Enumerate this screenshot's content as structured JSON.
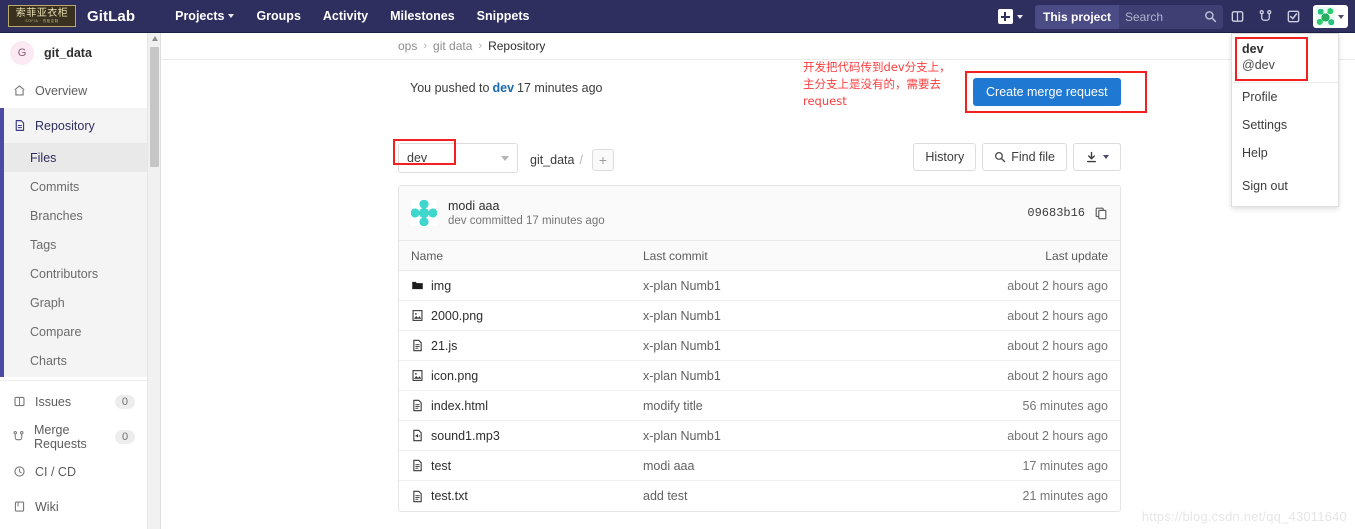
{
  "navbar": {
    "logo_cn": "索菲亚衣柜",
    "logo_sub": "SOFIA · 衣柜定制",
    "brand": "GitLab",
    "links": [
      {
        "label": "Projects",
        "has_caret": true
      },
      {
        "label": "Groups",
        "has_caret": false
      },
      {
        "label": "Activity",
        "has_caret": false
      },
      {
        "label": "Milestones",
        "has_caret": false
      },
      {
        "label": "Snippets",
        "has_caret": false
      }
    ],
    "plus_icon": "plus-icon",
    "scope_label": "This project",
    "search_placeholder": "Search",
    "search_icon": "search-icon",
    "icons": [
      {
        "name": "issues-icon"
      },
      {
        "name": "merge-requests-icon"
      },
      {
        "name": "todos-icon"
      }
    ],
    "avatar_icon": "user-avatar"
  },
  "sidebar": {
    "project_initial": "G",
    "project_name": "git_data",
    "overview": {
      "label": "Overview",
      "icon": "home-icon"
    },
    "repository": {
      "label": "Repository",
      "icon": "file-icon"
    },
    "repo_children": [
      {
        "label": "Files",
        "selected": true
      },
      {
        "label": "Commits",
        "selected": false
      },
      {
        "label": "Branches",
        "selected": false
      },
      {
        "label": "Tags",
        "selected": false
      },
      {
        "label": "Contributors",
        "selected": false
      },
      {
        "label": "Graph",
        "selected": false
      },
      {
        "label": "Compare",
        "selected": false
      },
      {
        "label": "Charts",
        "selected": false
      }
    ],
    "bottom_items": [
      {
        "label": "Issues",
        "badge": "0",
        "icon": "issues-icon"
      },
      {
        "label": "Merge Requests",
        "badge": "0",
        "icon": "merge-icon"
      },
      {
        "label": "CI / CD",
        "badge": "",
        "icon": "pipeline-icon"
      },
      {
        "label": "Wiki",
        "badge": "",
        "icon": "book-icon"
      }
    ]
  },
  "breadcrumb": {
    "root": "ops",
    "sep": "›",
    "project": "git data",
    "current": "Repository"
  },
  "push_notice": {
    "prefix": "You pushed to",
    "branch": "dev",
    "suffix": "17 minutes ago"
  },
  "annotation": {
    "text": "开发把代码传到dev分支上，主分支上是没有的，需要去request",
    "color": "#fc3d3d"
  },
  "merge_request": {
    "button_label": "Create merge request",
    "accent": "#1f78d1",
    "highlight": "#f32020"
  },
  "toolbar": {
    "branch": "dev",
    "project_path": "git_data",
    "path_sep": "/",
    "add_label": "+",
    "history_label": "History",
    "find_file_label": "Find file",
    "find_file_icon": "search-icon",
    "download_icon": "download-icon"
  },
  "commit": {
    "title": "modi aaa",
    "meta": "dev committed 17 minutes ago",
    "sha": "09683b16",
    "copy_icon": "copy-icon",
    "avatar_icon": "identicon"
  },
  "file_table": {
    "headers": {
      "name": "Name",
      "commit": "Last commit",
      "update": "Last update"
    },
    "rows": [
      {
        "icon": "folder-icon",
        "name": "img",
        "commit": "x-plan Numb1",
        "update": "about 2 hours ago"
      },
      {
        "icon": "image-file-icon",
        "name": "2000.png",
        "commit": "x-plan Numb1",
        "update": "about 2 hours ago"
      },
      {
        "icon": "text-file-icon",
        "name": "21.js",
        "commit": "x-plan Numb1",
        "update": "about 2 hours ago"
      },
      {
        "icon": "image-file-icon",
        "name": "icon.png",
        "commit": "x-plan Numb1",
        "update": "about 2 hours ago"
      },
      {
        "icon": "text-file-icon",
        "name": "index.html",
        "commit": "modify title",
        "update": "56 minutes ago"
      },
      {
        "icon": "audio-file-icon",
        "name": "sound1.mp3",
        "commit": "x-plan Numb1",
        "update": "about 2 hours ago"
      },
      {
        "icon": "text-file-icon",
        "name": "test",
        "commit": "modi aaa",
        "update": "17 minutes ago"
      },
      {
        "icon": "text-file-icon",
        "name": "test.txt",
        "commit": "add test",
        "update": "21 minutes ago"
      }
    ]
  },
  "user_menu": {
    "name": "dev",
    "handle": "@dev",
    "items": [
      "Profile",
      "Settings",
      "Help"
    ],
    "sign_out": "Sign out",
    "highlight": "#f32020"
  },
  "watermark": "https://blog.csdn.net/qq_43011640"
}
